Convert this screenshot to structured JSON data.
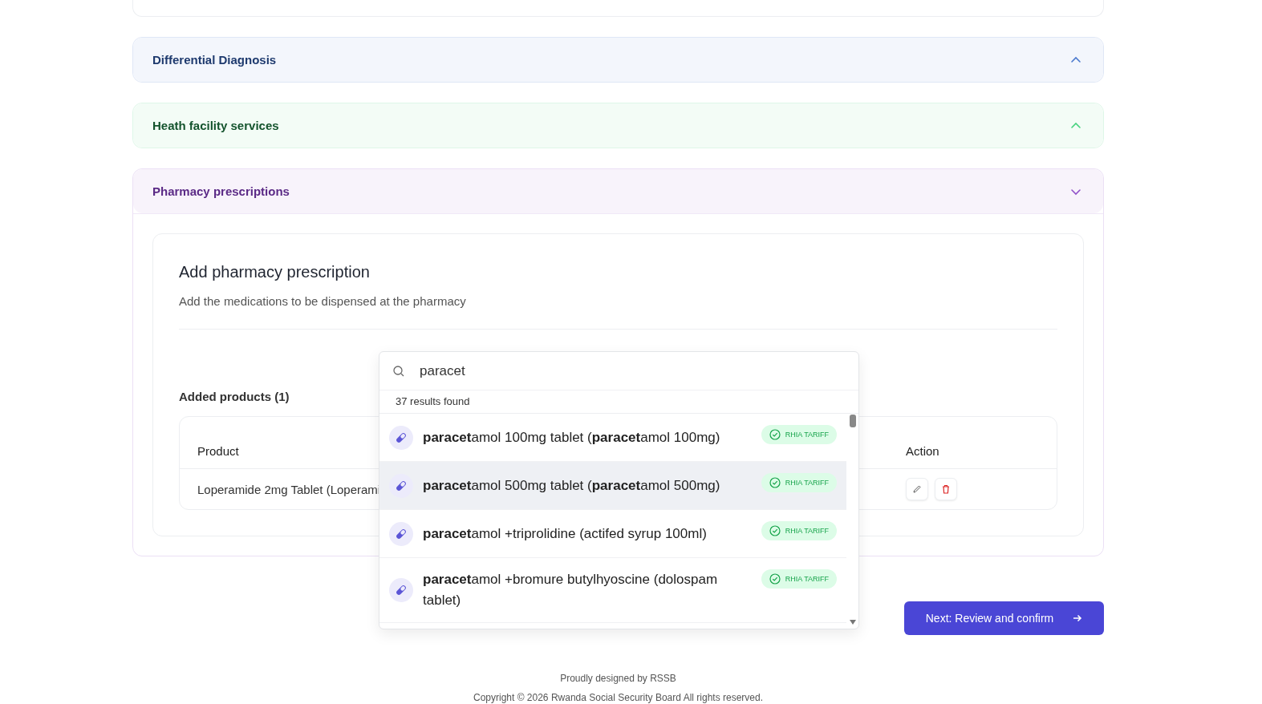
{
  "sections": [
    {
      "title": "Differential Diagnosis",
      "color": "#1e3a6e",
      "expanded": false
    },
    {
      "title": "Heath facility services",
      "color": "#14532d",
      "expanded": false
    },
    {
      "title": "Pharmacy prescriptions",
      "color": "#5b2a86",
      "expanded": true
    }
  ],
  "prescription": {
    "title": "Add pharmacy prescription",
    "subtitle": "Add the medications to be dispensed at the pharmacy",
    "added_label": "Added products (1)",
    "table": {
      "columns": [
        "Product",
        "Action"
      ],
      "rows": [
        {
          "product": "Loperamide 2mg Tablet (Loperami"
        }
      ]
    },
    "search": {
      "value": "paracet",
      "results_count": "37 results found",
      "results": [
        {
          "name": "**paracet**amol 100mg tablet (**paracet**amol 100mg)",
          "badge": "RHIA TARIFF",
          "selected": false
        },
        {
          "name": "**paracet**amol 500mg tablet (**paracet**amol 500mg)",
          "badge": "RHIA TARIFF",
          "selected": true
        },
        {
          "name": "**paracet**amol +triprolidine (actifed syrup 100ml)",
          "badge": "RHIA TARIFF",
          "selected": false
        },
        {
          "name": "**paracet**amol +bromure butylhyoscine (dolospam tablet)",
          "badge": "RHIA TARIFF",
          "selected": false
        }
      ]
    }
  },
  "next_button": "Next: Review and confirm",
  "footer": [
    "Proudly designed by RSSB",
    "Copyright © 2026 Rwanda Social Security Board All rights reserved."
  ]
}
